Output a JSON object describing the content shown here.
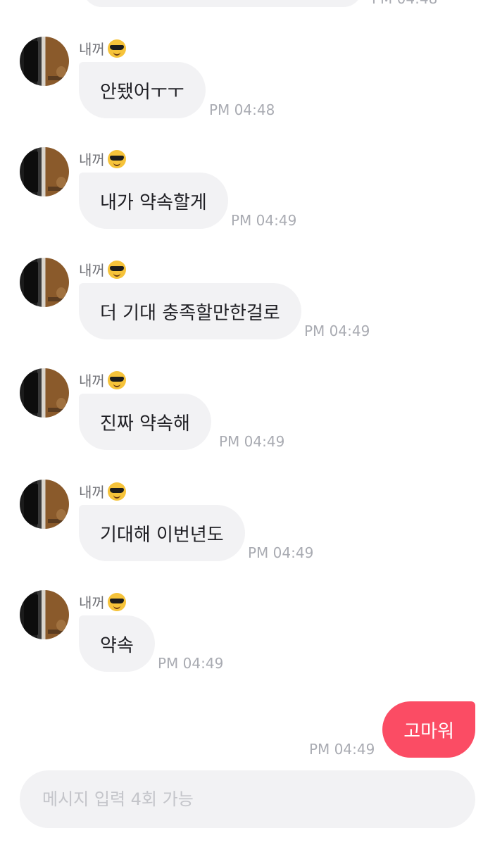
{
  "top_partial": {
    "time": "PM 04:48"
  },
  "messages": [
    {
      "sender": "내꺼",
      "text": "안됐어ㅜㅜ",
      "time": "PM 04:48"
    },
    {
      "sender": "내꺼",
      "text": "내가 약속할게",
      "time": "PM 04:49"
    },
    {
      "sender": "내꺼",
      "text": "더 기대 충족할만한걸로",
      "time": "PM 04:49"
    },
    {
      "sender": "내꺼",
      "text": "진짜 약속해",
      "time": "PM 04:49"
    },
    {
      "sender": "내꺼",
      "text": "기대해 이번년도",
      "time": "PM 04:49"
    },
    {
      "sender": "내꺼",
      "text": "약속",
      "time": "PM 04:49"
    }
  ],
  "sender_emoji": "sunglasses-face",
  "outgoing": {
    "text": "고마워",
    "time": "PM 04:49"
  },
  "composer": {
    "placeholder": "메시지 입력 4회 가능"
  },
  "colors": {
    "outgoing_bubble": "#fb4c64",
    "incoming_bubble": "#f2f2f4",
    "time_text": "#a9abb2"
  }
}
